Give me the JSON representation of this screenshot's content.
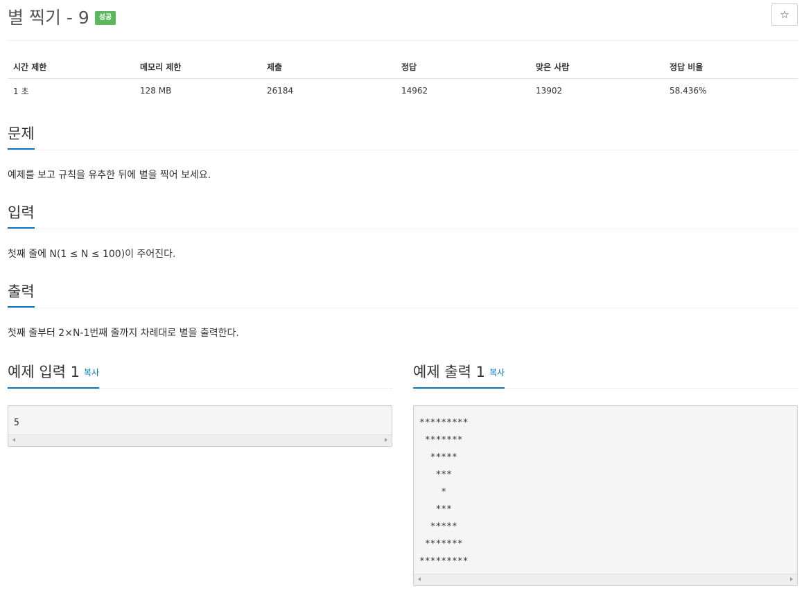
{
  "problem": {
    "title": "별 찍기 - 9",
    "badge": "성공",
    "star_icon": "☆"
  },
  "info": {
    "headers": [
      "시간 제한",
      "메모리 제한",
      "제출",
      "정답",
      "맞은 사람",
      "정답 비율"
    ],
    "values": [
      "1 초",
      "128 MB",
      "26184",
      "14962",
      "13902",
      "58.436%"
    ]
  },
  "sections": {
    "problem": {
      "title": "문제",
      "text": "예제를 보고 규칙을 유추한 뒤에 별을 찍어 보세요."
    },
    "input": {
      "title": "입력",
      "text": "첫째 줄에 N(1 ≤ N ≤ 100)이 주어진다."
    },
    "output": {
      "title": "출력",
      "text": "첫째 줄부터 2×N-1번째 줄까지 차례대로 별을 출력한다."
    }
  },
  "samples": {
    "input": {
      "title": "예제 입력 1",
      "copy_label": "복사",
      "content": "5"
    },
    "output": {
      "title": "예제 출력 1",
      "copy_label": "복사",
      "content": "*********\n *******\n  *****\n   ***\n    *\n   ***\n  *****\n *******\n*********"
    }
  },
  "colors": {
    "accent": "#0076c0",
    "success_badge": "#5cb85c"
  }
}
